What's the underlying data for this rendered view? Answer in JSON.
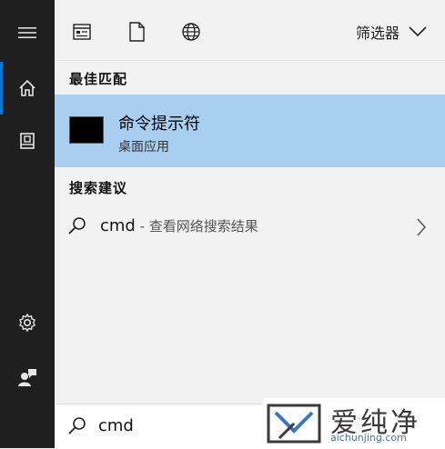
{
  "sidebar": {
    "icons": [
      "hamburger-menu-icon",
      "home-icon",
      "documents-icon",
      "settings-gear-icon",
      "user-feedback-icon"
    ]
  },
  "topbar": {
    "icons": [
      "apps-icon",
      "documents-icon",
      "web-globe-icon"
    ],
    "filter_label": "筛选器"
  },
  "results": {
    "best_match_label": "最佳匹配",
    "best_match": {
      "title": "命令提示符",
      "subtitle": "桌面应用",
      "highlight_color": "#a8cff0"
    },
    "suggestions_label": "搜索建议",
    "suggestion": {
      "query": "cmd",
      "hint": " - 查看网络搜索结果"
    }
  },
  "search": {
    "value": "cmd"
  },
  "watermark": {
    "brand": "爱纯净",
    "url": "aichunjing.com"
  },
  "colors": {
    "rail": "#1f1f1f",
    "accent": "#0078d7"
  }
}
